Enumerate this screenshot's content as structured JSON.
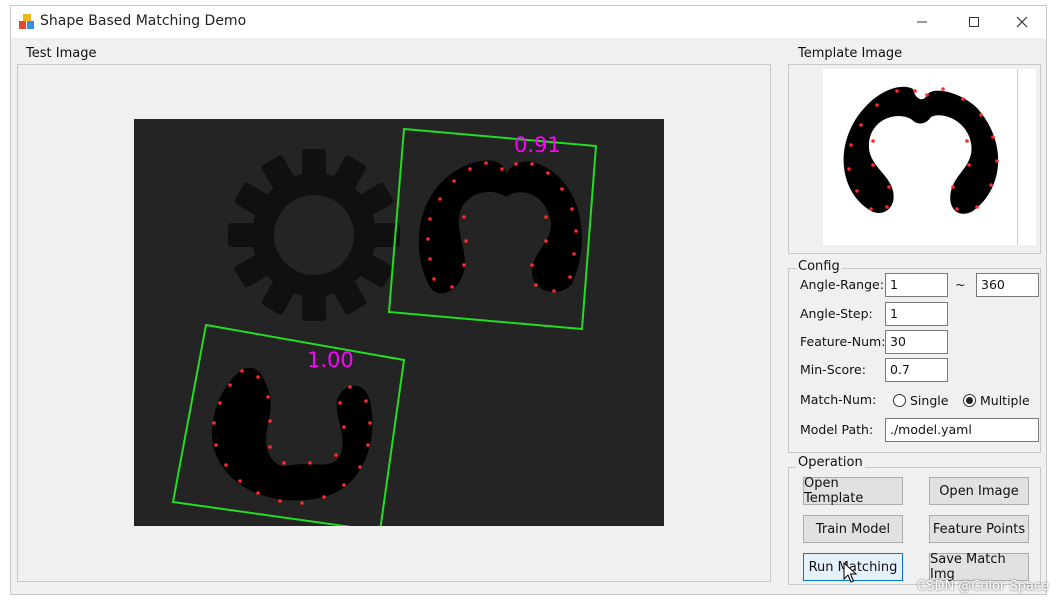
{
  "window": {
    "title": "Shape Based Matching Demo",
    "minimize_icon": "minimize-icon",
    "maximize_icon": "maximize-icon",
    "close_icon": "close-icon"
  },
  "test_image": {
    "group_title": "Test Image",
    "matches": [
      {
        "score": "1.00",
        "color": "#ff00ff"
      },
      {
        "score": "0.91",
        "color": "#ff00ff"
      }
    ],
    "box_color": "#22dd22",
    "point_color": "#ff2a2a",
    "background_color": "#242424"
  },
  "template_image": {
    "group_title": "Template Image"
  },
  "config": {
    "group_title": "Config",
    "angle_range_label": "Angle-Range:",
    "angle_range_from": "1",
    "angle_range_sep": "~",
    "angle_range_to": "360",
    "angle_step_label": "Angle-Step:",
    "angle_step": "1",
    "feature_num_label": "Feature-Num:",
    "feature_num": "30",
    "min_score_label": "Min-Score:",
    "min_score": "0.7",
    "match_num_label": "Match-Num:",
    "match_num_options": [
      "Single",
      "Multiple"
    ],
    "match_num_selected": "Multiple",
    "model_path_label": "Model Path:",
    "model_path": "./model.yaml"
  },
  "operation": {
    "group_title": "Operation",
    "open_template": "Open Template",
    "open_image": "Open Image",
    "train_model": "Train Model",
    "feature_points": "Feature Points",
    "run_matching": "Run Matching",
    "save_match_img": "Save Match Img"
  },
  "watermark": "CSDN @Color Space"
}
